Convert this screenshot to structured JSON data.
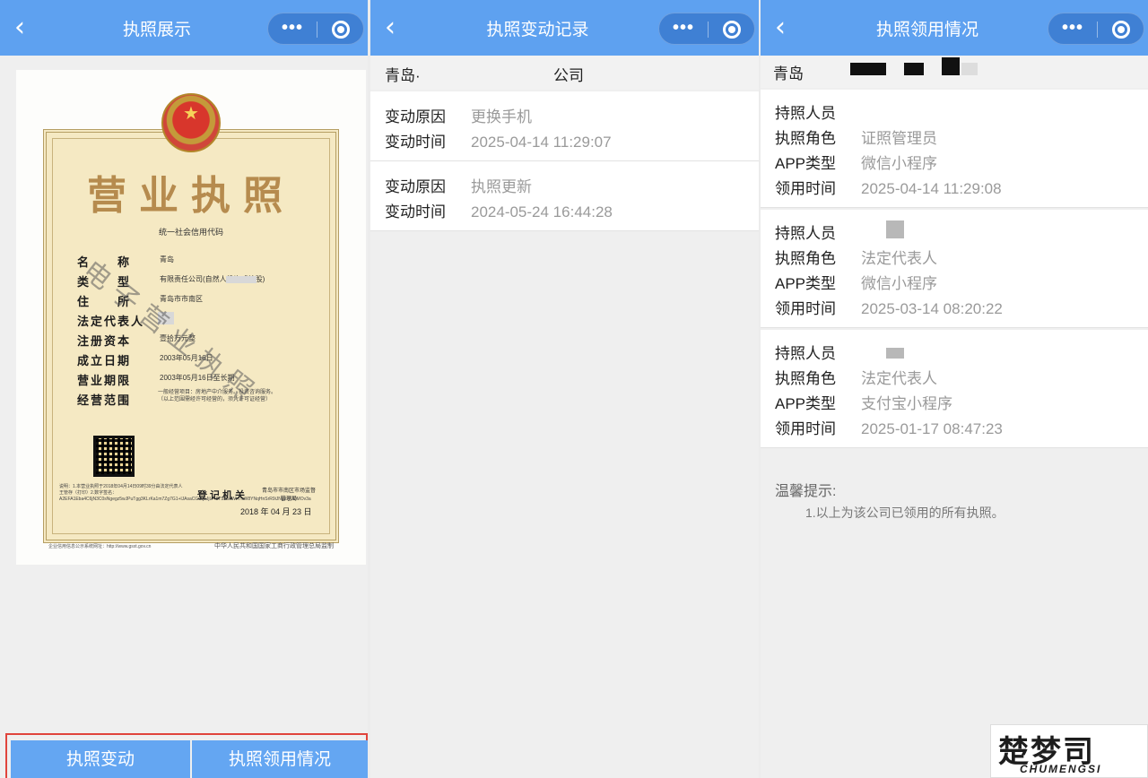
{
  "panel1": {
    "nav": {
      "back": "‹",
      "title": "执照展示",
      "more": "•••"
    },
    "certificate": {
      "title": "营业执照",
      "code_label": "统一社会信用代码",
      "rows": [
        {
          "label": "名　　称",
          "value": "青岛"
        },
        {
          "label": "类　　型",
          "value": "有限责任公司(自然人投资或控股)"
        },
        {
          "label": "住　　所",
          "value": "青岛市市南区"
        },
        {
          "label": "法定代表人",
          "value": ""
        },
        {
          "label": "注册资本",
          "value": "壹拾万元整"
        },
        {
          "label": "成立日期",
          "value": "2003年05月16日"
        },
        {
          "label": "营业期限",
          "value": "2003年05月16日至长期"
        },
        {
          "label": "经营范围",
          "value": ""
        }
      ],
      "scope_text": "一般经营项目：房地产中介服务。投资咨询服务。（以上范围需经许可经营的，须凭许可证经营）",
      "notes": "说明：1.本营业执照于2018年04月14日09时39分由法定代表人王管存（打印）2.数字签名：A2EFA1Eba4C6jN3C0sNgegz5wJPuTgg3KLrKa1m7Zg7G1+lJAsaCGC/jvJjL/+87S58AWH7LW8YNqHnSrR9iJNgmyUDMOv3a",
      "reg_org": "登记机关",
      "reg_org_name": "青岛市市南区市场监督管理局",
      "reg_date": "2018 年 04 月 23 日",
      "watermark": "电子营业执照",
      "footer_left": "企业信用信息公示系统网址：http://www.gsxt.gov.cn",
      "footer_right": "中华人民共和国国家工商行政管理总局监制"
    },
    "buttons": {
      "change": "执照变动",
      "usage": "执照领用情况"
    }
  },
  "panel2": {
    "nav": {
      "back": "‹",
      "title": "执照变动记录",
      "more": "•••"
    },
    "company_a": "青岛·",
    "company_b": "公司",
    "records": [
      {
        "reason_label": "变动原因",
        "reason": "更换手机",
        "time_label": "变动时间",
        "time": "2025-04-14 11:29:07"
      },
      {
        "reason_label": "变动原因",
        "reason": "执照更新",
        "time_label": "变动时间",
        "time": "2024-05-24 16:44:28"
      }
    ]
  },
  "panel3": {
    "nav": {
      "back": "‹",
      "title": "执照领用情况",
      "more": "•••"
    },
    "company": "青岛",
    "usages": [
      {
        "holder_label": "持照人员",
        "holder": "",
        "role_label": "执照角色",
        "role": "证照管理员",
        "app_label": "APP类型",
        "app": "微信小程序",
        "time_label": "领用时间",
        "time": "2025-04-14 11:29:08"
      },
      {
        "holder_label": "持照人员",
        "holder": "",
        "role_label": "执照角色",
        "role": "法定代表人",
        "app_label": "APP类型",
        "app": "微信小程序",
        "time_label": "领用时间",
        "time": "2025-03-14 08:20:22"
      },
      {
        "holder_label": "持照人员",
        "holder": "",
        "role_label": "执照角色",
        "role": "法定代表人",
        "app_label": "APP类型",
        "app": "支付宝小程序",
        "time_label": "领用时间",
        "time": "2025-01-17 08:47:23"
      }
    ],
    "tip_title": "温馨提示:",
    "tip_line": "1.以上为该公司已领用的所有执照。"
  },
  "logo": {
    "mark": "楚梦司",
    "text": "CHUMENGSI"
  },
  "colors": {
    "nav": "#5ea1f0",
    "capsule": "#3f80d4",
    "button": "#64a6f2",
    "highlight": "#e0443c"
  }
}
